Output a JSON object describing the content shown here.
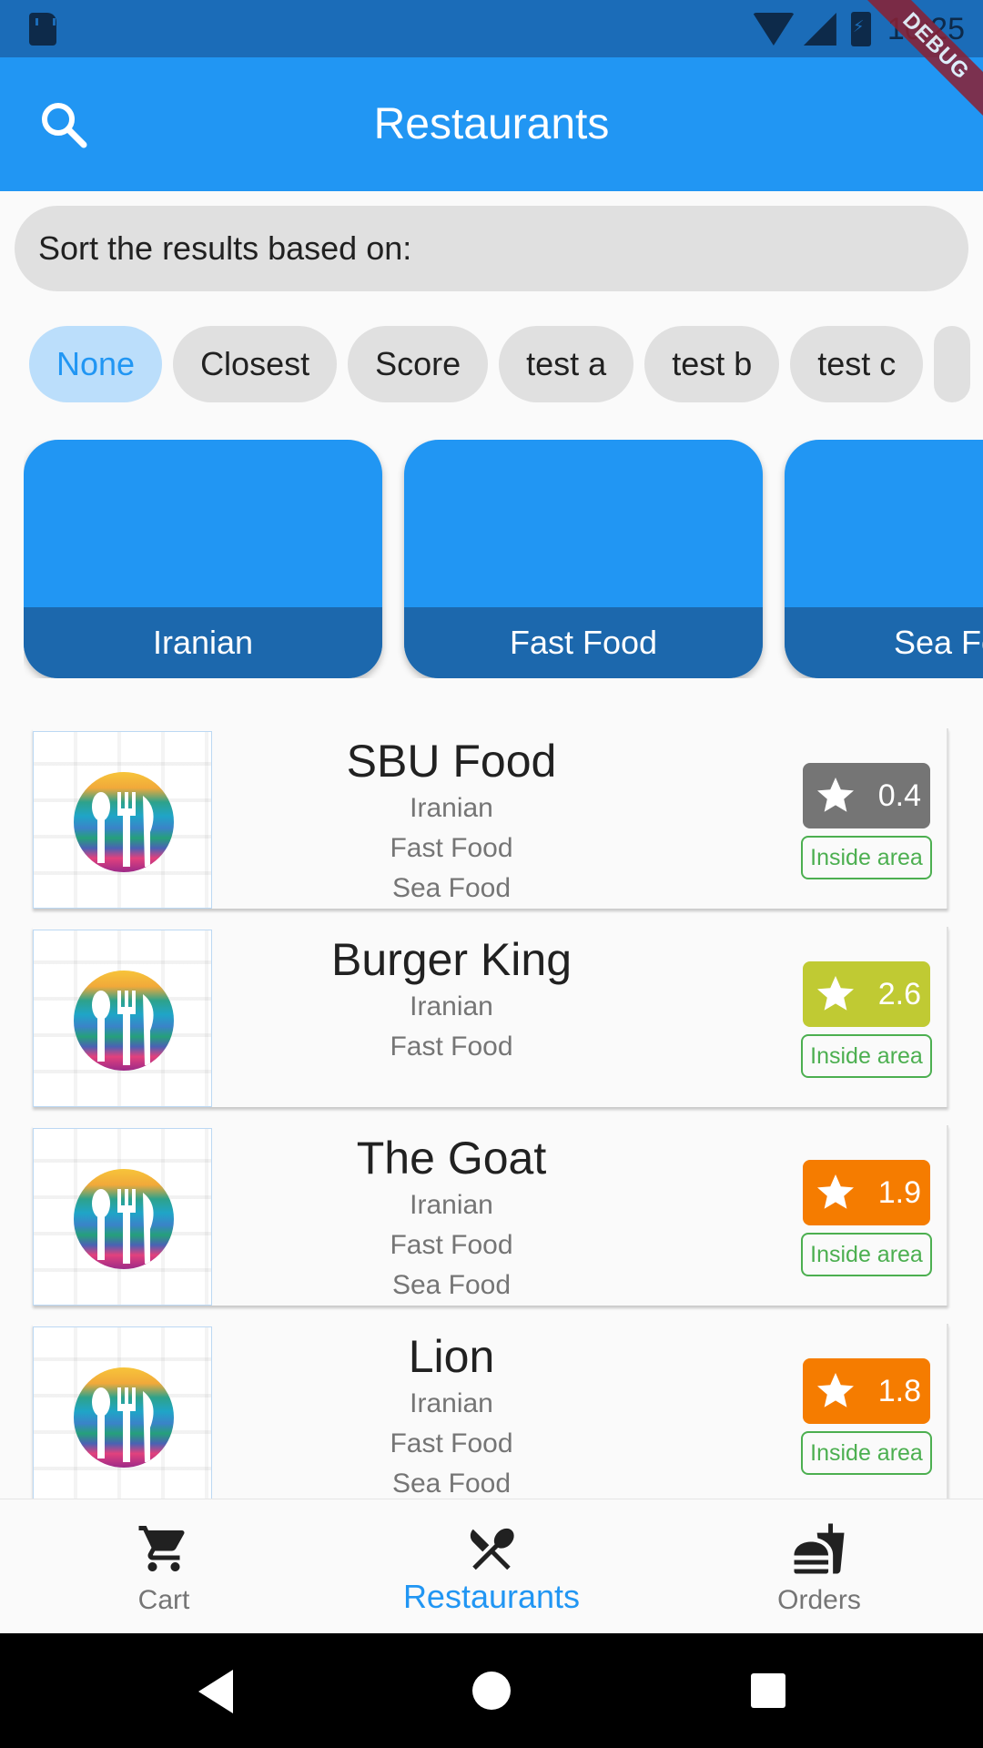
{
  "status_bar": {
    "time": "10:25"
  },
  "debug_banner": "DEBUG",
  "app_bar": {
    "title": "Restaurants",
    "search_icon": "search-icon"
  },
  "sort": {
    "label": "Sort the results based on:"
  },
  "chips": [
    {
      "label": "None",
      "selected": true
    },
    {
      "label": "Closest",
      "selected": false
    },
    {
      "label": "Score",
      "selected": false
    },
    {
      "label": "test a",
      "selected": false
    },
    {
      "label": "test b",
      "selected": false
    },
    {
      "label": "test c",
      "selected": false
    }
  ],
  "categories": [
    {
      "label": "Iranian"
    },
    {
      "label": "Fast Food"
    },
    {
      "label": "Sea Fo"
    }
  ],
  "restaurants": [
    {
      "name": "SBU Food",
      "categories": [
        "Iranian",
        "Fast Food",
        "Sea Food"
      ],
      "rating": "0.4",
      "rating_color": "#757575",
      "area": "Inside area"
    },
    {
      "name": "Burger King",
      "categories": [
        "Iranian",
        "Fast Food"
      ],
      "rating": "2.6",
      "rating_color": "#c0ca33",
      "area": "Inside area"
    },
    {
      "name": "The Goat",
      "categories": [
        "Iranian",
        "Fast Food",
        "Sea Food"
      ],
      "rating": "1.9",
      "rating_color": "#f57c00",
      "area": "Inside area"
    },
    {
      "name": "Lion",
      "categories": [
        "Iranian",
        "Fast Food",
        "Sea Food"
      ],
      "rating": "1.8",
      "rating_color": "#f57c00",
      "area": "Inside area"
    }
  ],
  "bottom_nav": [
    {
      "label": "Cart",
      "icon": "cart-icon",
      "active": false
    },
    {
      "label": "Restaurants",
      "icon": "fork-spoon-icon",
      "active": true
    },
    {
      "label": "Orders",
      "icon": "food-tray-icon",
      "active": false
    }
  ],
  "colors": {
    "primary": "#2196f3",
    "status_bar": "#1b6cb8",
    "category_label": "#1c68ad",
    "inside_area": "#4caf50"
  }
}
